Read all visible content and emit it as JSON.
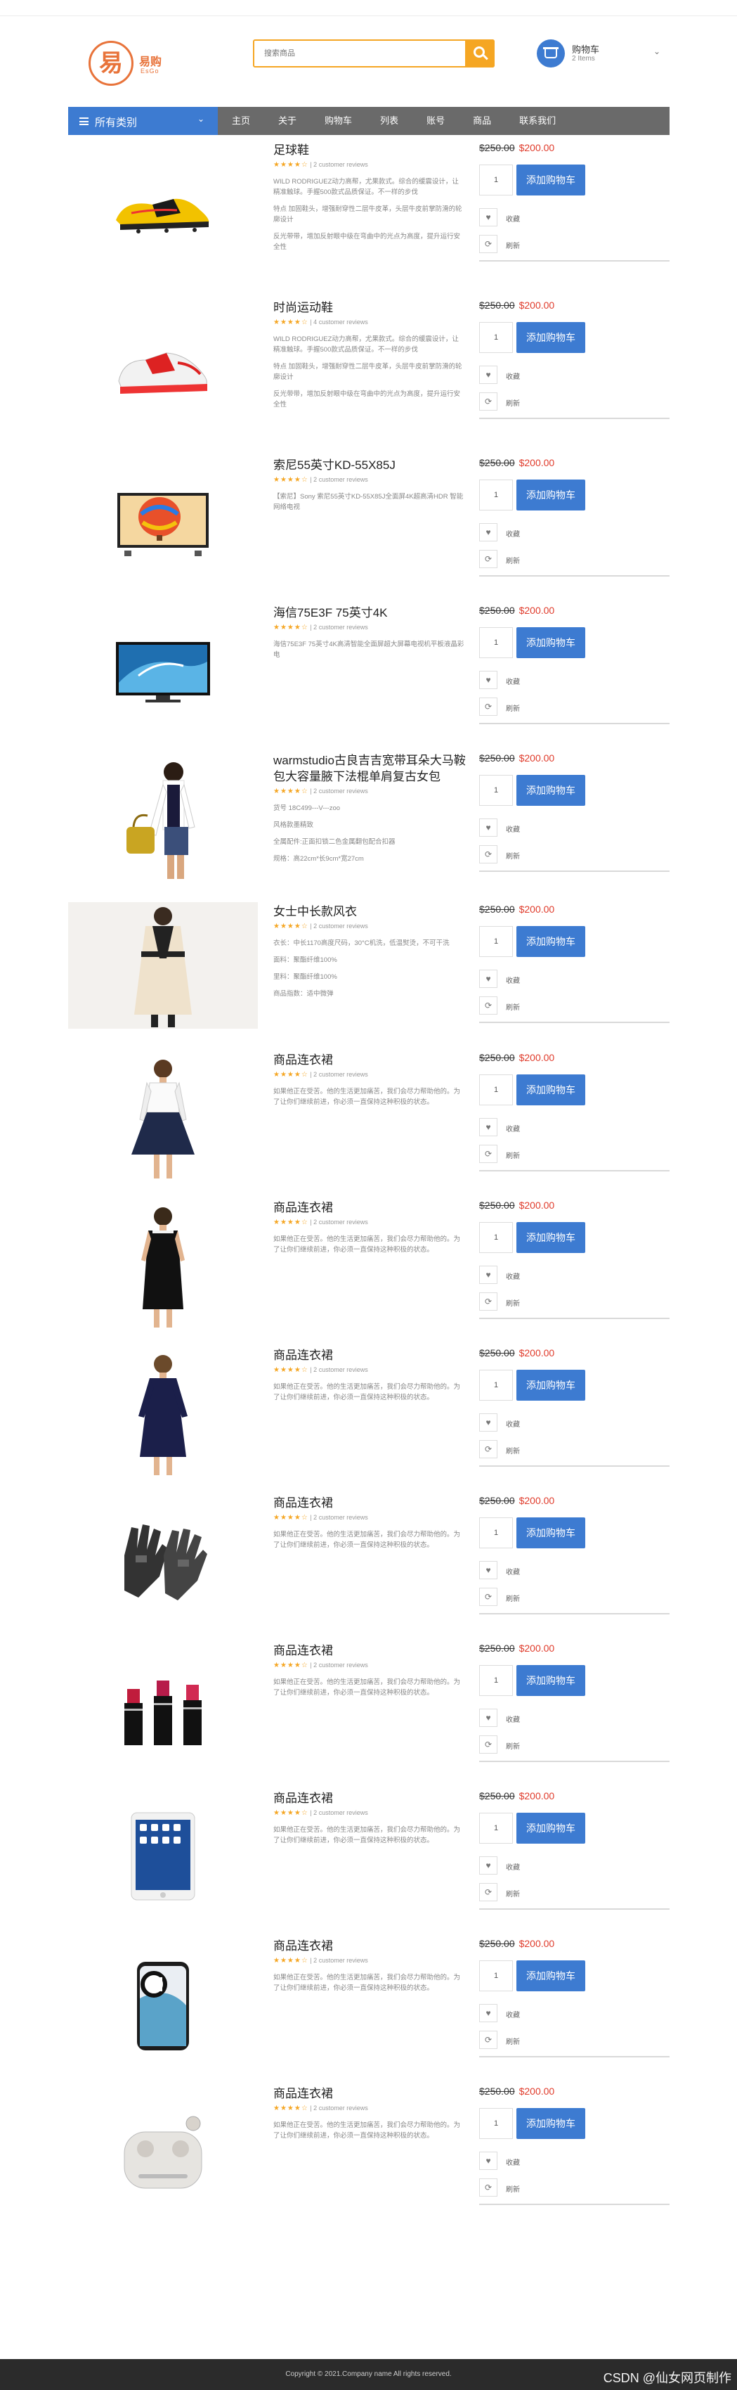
{
  "logo": {
    "cn": "易购",
    "en": "EsGo"
  },
  "search": {
    "placeholder": "搜索商品"
  },
  "cart": {
    "title": "购物车",
    "count": "2 Items"
  },
  "nav": {
    "category": "所有类别",
    "items": [
      "主页",
      "关于",
      "购物车",
      "列表",
      "账号",
      "商品",
      "联系我们"
    ]
  },
  "labels": {
    "add_to_cart": "添加购物车",
    "favorite": "收藏",
    "compare": "刷新",
    "qty": "1"
  },
  "products": [
    {
      "title": "足球鞋",
      "rating": "| 2 customer reviews",
      "old_price": "$250.00",
      "new_price": "$200.00",
      "image": "football-boot",
      "desc": [
        "WILD RODRIGUEZ动力高帮，尤果款式。综合的缓震设计，让精准触球。手握500款式品质保证。不一样的步伐",
        "特点 加固鞋头，增强耐穿性二层牛皮革，头层牛皮前掌防滑的轮廓设计",
        "反光带带，增加反射眼中级在弯曲中的光点为高度，提升运行安全性"
      ]
    },
    {
      "title": "时尚运动鞋",
      "rating": "| 4 customer reviews",
      "old_price": "$250.00",
      "new_price": "$200.00",
      "image": "sneaker",
      "desc": [
        "WILD RODRIGUEZ动力高帮，尤果款式。综合的缓震设计，让精准触球。手握500款式品质保证。不一样的步伐",
        "特点 加固鞋头，增强耐穿性二层牛皮革，头层牛皮前掌防滑的轮廓设计",
        "反光带带，增加反射眼中级在弯曲中的光点为高度，提升运行安全性"
      ]
    },
    {
      "title": "索尼55英寸KD-55X85J",
      "rating": "| 2 customer reviews",
      "old_price": "$250.00",
      "new_price": "$200.00",
      "image": "tv-balloon",
      "desc": [
        "【索尼】Sony 索尼55英寸KD-55X85J全面屏4K超高清HDR 智能网络电视"
      ]
    },
    {
      "title": "海信75E3F 75英寸4K",
      "rating": "| 2 customer reviews",
      "old_price": "$250.00",
      "new_price": "$200.00",
      "image": "tv-wave",
      "desc": [
        "海信75E3F 75英寸4K高清智能全面屏超大屏幕电视机平板液晶彩电"
      ]
    },
    {
      "title": "warmstudio古良吉吉宽带耳朵大马鞍包大容量腋下法棍单肩复古女包",
      "rating": "| 2 customer reviews",
      "old_price": "$250.00",
      "new_price": "$200.00",
      "image": "handbag",
      "desc": [
        "货号 18C499---V---zoo",
        "风格款墨精致",
        "全属配件:正面扣锁二色金属翻包配合扣器",
        "规格：高22cm*长9cm*宽27cm"
      ]
    },
    {
      "title": "女士中长款风衣",
      "rating": "| 2 customer reviews",
      "old_price": "$250.00",
      "new_price": "$200.00",
      "image": "trench-coat",
      "desc": [
        "衣长：中长1170高度尺码，30°C机洗，低温熨烫，不可干洗",
        "面料：聚酯纤维100%",
        "里料：聚酯纤维100%",
        "商品指数：适中微弹"
      ]
    },
    {
      "title": "商品连衣裙",
      "rating": "| 2 customer reviews",
      "old_price": "$250.00",
      "new_price": "$200.00",
      "image": "dress-lace",
      "desc": [
        "如果他正在受苦。他的生活更加痛苦，我们会尽力帮助他的。为了让你们继续前进，你必须一直保持这种积极的状态。"
      ]
    },
    {
      "title": "商品连衣裙",
      "rating": "| 2 customer reviews",
      "old_price": "$250.00",
      "new_price": "$200.00",
      "image": "dress-black",
      "desc": [
        "如果他正在受苦。他的生活更加痛苦，我们会尽力帮助他的。为了让你们继续前进，你必须一直保持这种积极的状态。"
      ]
    },
    {
      "title": "商品连衣裙",
      "rating": "| 2 customer reviews",
      "old_price": "$250.00",
      "new_price": "$200.00",
      "image": "dress-navy",
      "desc": [
        "如果他正在受苦。他的生活更加痛苦，我们会尽力帮助他的。为了让你们继续前进，你必须一直保持这种积极的状态。"
      ]
    },
    {
      "title": "商品连衣裙",
      "rating": "| 2 customer reviews",
      "old_price": "$250.00",
      "new_price": "$200.00",
      "image": "gloves",
      "desc": [
        "如果他正在受苦。他的生活更加痛苦，我们会尽力帮助他的。为了让你们继续前进，你必须一直保持这种积极的状态。"
      ]
    },
    {
      "title": "商品连衣裙",
      "rating": "| 2 customer reviews",
      "old_price": "$250.00",
      "new_price": "$200.00",
      "image": "lipsticks",
      "desc": [
        "如果他正在受苦。他的生活更加痛苦，我们会尽力帮助他的。为了让你们继续前进，你必须一直保持这种积极的状态。"
      ]
    },
    {
      "title": "商品连衣裙",
      "rating": "| 2 customer reviews",
      "old_price": "$250.00",
      "new_price": "$200.00",
      "image": "tablet",
      "desc": [
        "如果他正在受苦。他的生活更加痛苦，我们会尽力帮助他的。为了让你们继续前进，你必须一直保持这种积极的状态。"
      ]
    },
    {
      "title": "商品连衣裙",
      "rating": "| 2 customer reviews",
      "old_price": "$250.00",
      "new_price": "$200.00",
      "image": "phone",
      "desc": [
        "如果他正在受苦。他的生活更加痛苦，我们会尽力帮助他的。为了让你们继续前进，你必须一直保持这种积极的状态。"
      ]
    },
    {
      "title": "商品连衣裙",
      "rating": "| 2 customer reviews",
      "old_price": "$250.00",
      "new_price": "$200.00",
      "image": "earbuds",
      "desc": [
        "如果他正在受苦。他的生活更加痛苦，我们会尽力帮助他的。为了让你们继续前进，你必须一直保持这种积极的状态。"
      ]
    }
  ],
  "footer": {
    "text": "Copyright © 2021.Company name All rights reserved."
  },
  "watermark": "CSDN @仙女网页制作"
}
